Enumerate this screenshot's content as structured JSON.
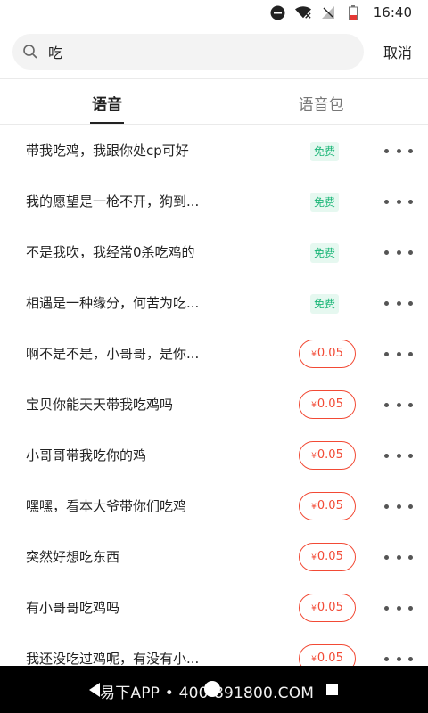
{
  "status_bar": {
    "time": "16:40",
    "icons": [
      "do-not-disturb-icon",
      "wifi-icon",
      "signal-icon",
      "battery-icon"
    ]
  },
  "search": {
    "query": "吃",
    "placeholder": "",
    "cancel_label": "取消"
  },
  "tabs": [
    {
      "label": "语音",
      "active": true
    },
    {
      "label": "语音包",
      "active": false
    }
  ],
  "items": [
    {
      "title": "带我吃鸡，我跟你处cp可好",
      "price": "免费",
      "free": true
    },
    {
      "title": "我的愿望是一枪不开，狗到...",
      "price": "免费",
      "free": true
    },
    {
      "title": "不是我吹，我经常0杀吃鸡的",
      "price": "免费",
      "free": true
    },
    {
      "title": "相遇是一种缘分，何苦为吃...",
      "price": "免费",
      "free": true
    },
    {
      "title": "啊不是不是，小哥哥，是你...",
      "price": "0.05",
      "free": false
    },
    {
      "title": "宝贝你能天天带我吃鸡吗",
      "price": "0.05",
      "free": false
    },
    {
      "title": "小哥哥带我吃你的鸡",
      "price": "0.05",
      "free": false
    },
    {
      "title": "嘿嘿，看本大爷带你们吃鸡",
      "price": "0.05",
      "free": false
    },
    {
      "title": "突然好想吃东西",
      "price": "0.05",
      "free": false
    },
    {
      "title": "有小哥哥吃鸡吗",
      "price": "0.05",
      "free": false
    },
    {
      "title": "我还没吃过鸡呢，有没有小...",
      "price": "0.05",
      "free": false
    }
  ],
  "currency_symbol": "¥",
  "nav_bar": {
    "watermark": "易下APP • 400-891800.COM"
  },
  "colors": {
    "free_badge_bg": "#e6f8f0",
    "free_badge_text": "#1bb677",
    "price_accent": "#f24a35"
  }
}
